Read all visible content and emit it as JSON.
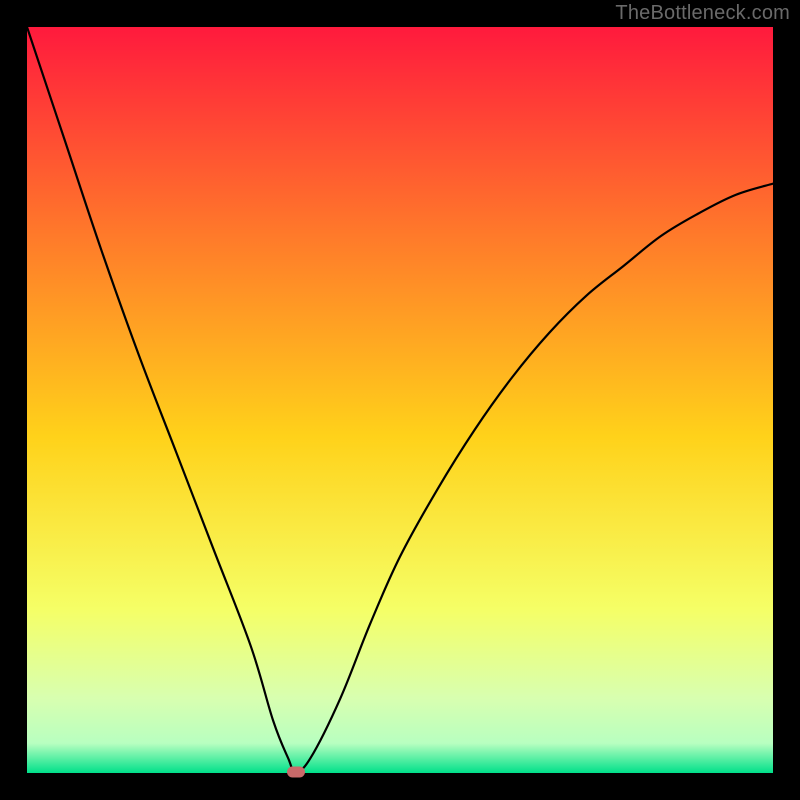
{
  "watermark": "TheBottleneck.com",
  "colors": {
    "frame_bg": "#000000",
    "gradient_top": "#ff1a3d",
    "gradient_upper_mid": "#ff7a2a",
    "gradient_mid": "#ffd21a",
    "gradient_lower_mid": "#f5ff66",
    "gradient_near_bottom": "#d8ffb0",
    "gradient_bottom": "#00e08a",
    "curve": "#000000",
    "marker": "#c96a6a"
  },
  "chart_data": {
    "type": "line",
    "title": "",
    "xlabel": "",
    "ylabel": "",
    "xlim": [
      0,
      100
    ],
    "ylim": [
      0,
      100
    ],
    "series": [
      {
        "name": "bottleneck-curve",
        "x": [
          0,
          5,
          10,
          15,
          20,
          25,
          30,
          33,
          35,
          36,
          38,
          42,
          46,
          50,
          55,
          60,
          65,
          70,
          75,
          80,
          85,
          90,
          95,
          100
        ],
        "y": [
          100,
          85,
          70,
          56,
          43,
          30,
          17,
          7,
          2,
          0.2,
          2,
          10,
          20,
          29,
          38,
          46,
          53,
          59,
          64,
          68,
          72,
          75,
          77.5,
          79
        ]
      }
    ],
    "annotations": [
      {
        "name": "optimal-marker",
        "x": 36,
        "y": 0.2
      }
    ],
    "grid": false,
    "legend": false
  }
}
